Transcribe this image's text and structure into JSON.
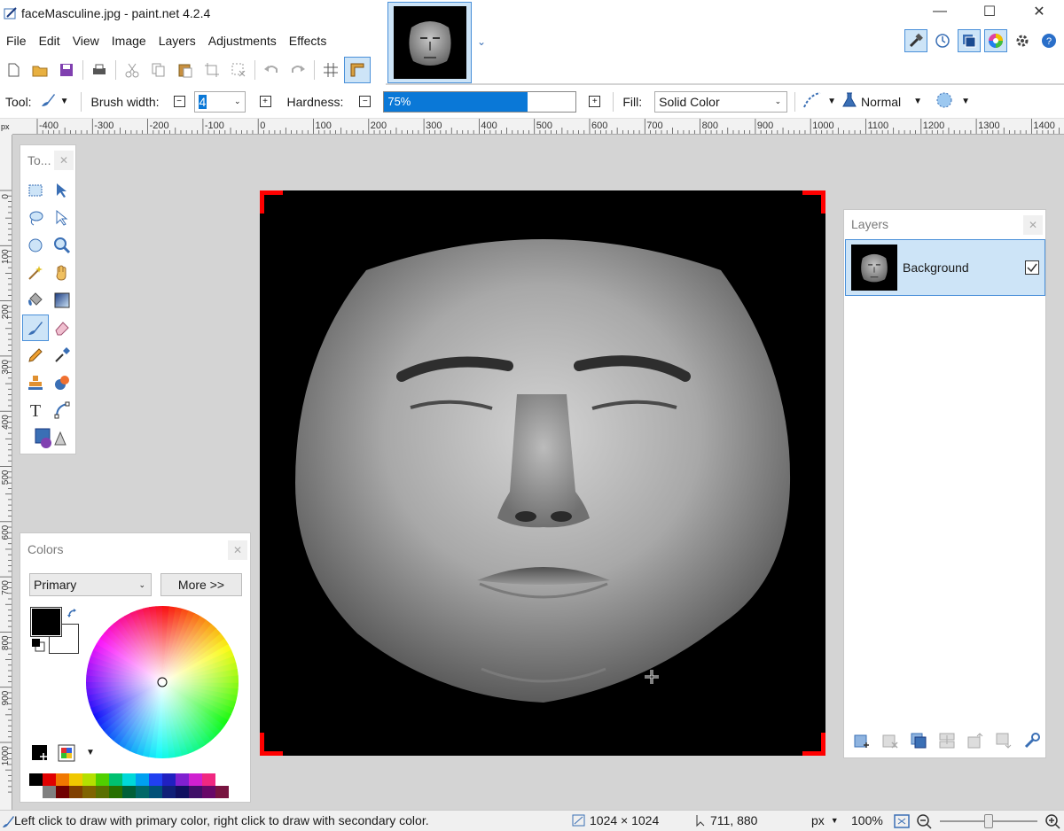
{
  "window": {
    "title": "faceMasculine.jpg - paint.net 4.2.4"
  },
  "menu": [
    "File",
    "Edit",
    "View",
    "Image",
    "Layers",
    "Adjustments",
    "Effects"
  ],
  "tool_options": {
    "tool_label": "Tool:",
    "brush_width_label": "Brush width:",
    "brush_width_value": "4",
    "hardness_label": "Hardness:",
    "hardness_value": "75%",
    "hardness_percent": 75,
    "fill_label": "Fill:",
    "fill_value": "Solid Color",
    "blend_mode": "Normal"
  },
  "rulers": {
    "horizontal": [
      "-400",
      "-300",
      "-200",
      "-100",
      "0",
      "100",
      "200",
      "300",
      "400",
      "500",
      "600",
      "700",
      "800",
      "900",
      "1000",
      "1100",
      "1200",
      "1300",
      "1400"
    ],
    "vertical": [
      "0",
      "100",
      "200",
      "300",
      "400",
      "500",
      "600",
      "700",
      "800",
      "900",
      "1000"
    ],
    "unit": "px"
  },
  "tools_panel": {
    "title": "To..."
  },
  "layers_panel": {
    "title": "Layers",
    "layers": [
      {
        "name": "Background",
        "visible": true,
        "selected": true
      }
    ]
  },
  "colors_panel": {
    "title": "Colors",
    "mode": "Primary",
    "more_button": "More >>",
    "primary_color": "#000000",
    "secondary_color": "#ffffff",
    "palette_top": [
      "#000000",
      "#e00000",
      "#f07800",
      "#f0c800",
      "#b4e000",
      "#50d000",
      "#00c070",
      "#00d8d8",
      "#00a0f0",
      "#2040f0",
      "#2020c0",
      "#8020d0",
      "#d020d0",
      "#f02880"
    ],
    "palette_bottom": [
      "#ffffff",
      "#808080",
      "#700000",
      "#804000",
      "#806400",
      "#5a7000",
      "#287000",
      "#006038",
      "#006868",
      "#005078",
      "#102078",
      "#101060",
      "#401068",
      "#680868",
      "#781440"
    ]
  },
  "status": {
    "hint": "Left click to draw with primary color, right click to draw with secondary color.",
    "image_size": "1024 × 1024",
    "cursor_pos": "711, 880",
    "unit": "px",
    "zoom": "100%"
  },
  "colors": {
    "accent": "#0a78d7",
    "selection": "#cde4f7",
    "canvas_corner": "#ff0000"
  }
}
